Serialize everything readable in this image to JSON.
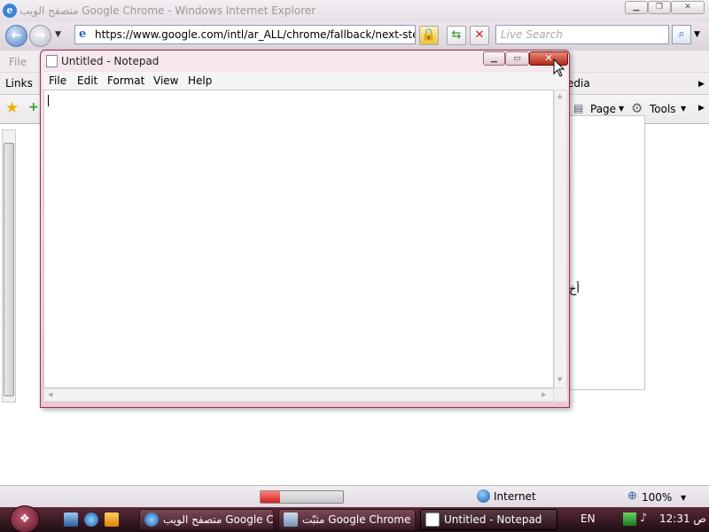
{
  "ie": {
    "title": "متصفح الويب Google Chrome - Windows Internet Explorer",
    "address": "https://www.google.com/intl/ar_ALL/chrome/fallback/next-step:",
    "search_placeholder": "Live Search",
    "menu_file": "File",
    "links_label": "Links",
    "links_tail": "edia",
    "page_label": "Page",
    "tools_label": "Tools",
    "page_fragment": "أخ",
    "status_zone": "Internet",
    "zoom": "100%",
    "progress_fraction": 0.24
  },
  "notepad": {
    "title": "Untitled - Notepad",
    "menus": [
      "File",
      "Edit",
      "Format",
      "View",
      "Help"
    ]
  },
  "taskbar": {
    "tasks": [
      {
        "label": "متصفح الويب Google C..."
      },
      {
        "label": "مثبّت Google Chrome"
      },
      {
        "label": "Untitled - Notepad"
      }
    ],
    "language": "EN",
    "clock": "12:31 ص"
  },
  "colors": {
    "taskbar": "#3c1c26",
    "notepad_border": "#a03040",
    "close_button": "#c0392b",
    "progress_fill": "#d02020"
  },
  "icons": [
    "ie-logo-icon",
    "back-arrow-icon",
    "forward-arrow-icon",
    "page-icon",
    "lock-icon",
    "refresh-icon",
    "stop-icon",
    "search-icon",
    "favorites-star-icon",
    "add-favorite-icon",
    "page-menu-icon",
    "tools-gear-icon",
    "globe-icon",
    "zoom-icon",
    "notepad-icon",
    "windows-start-icon",
    "show-desktop-icon",
    "switch-windows-icon",
    "media-player-icon",
    "chrome-installer-icon",
    "network-icon",
    "volume-icon"
  ]
}
